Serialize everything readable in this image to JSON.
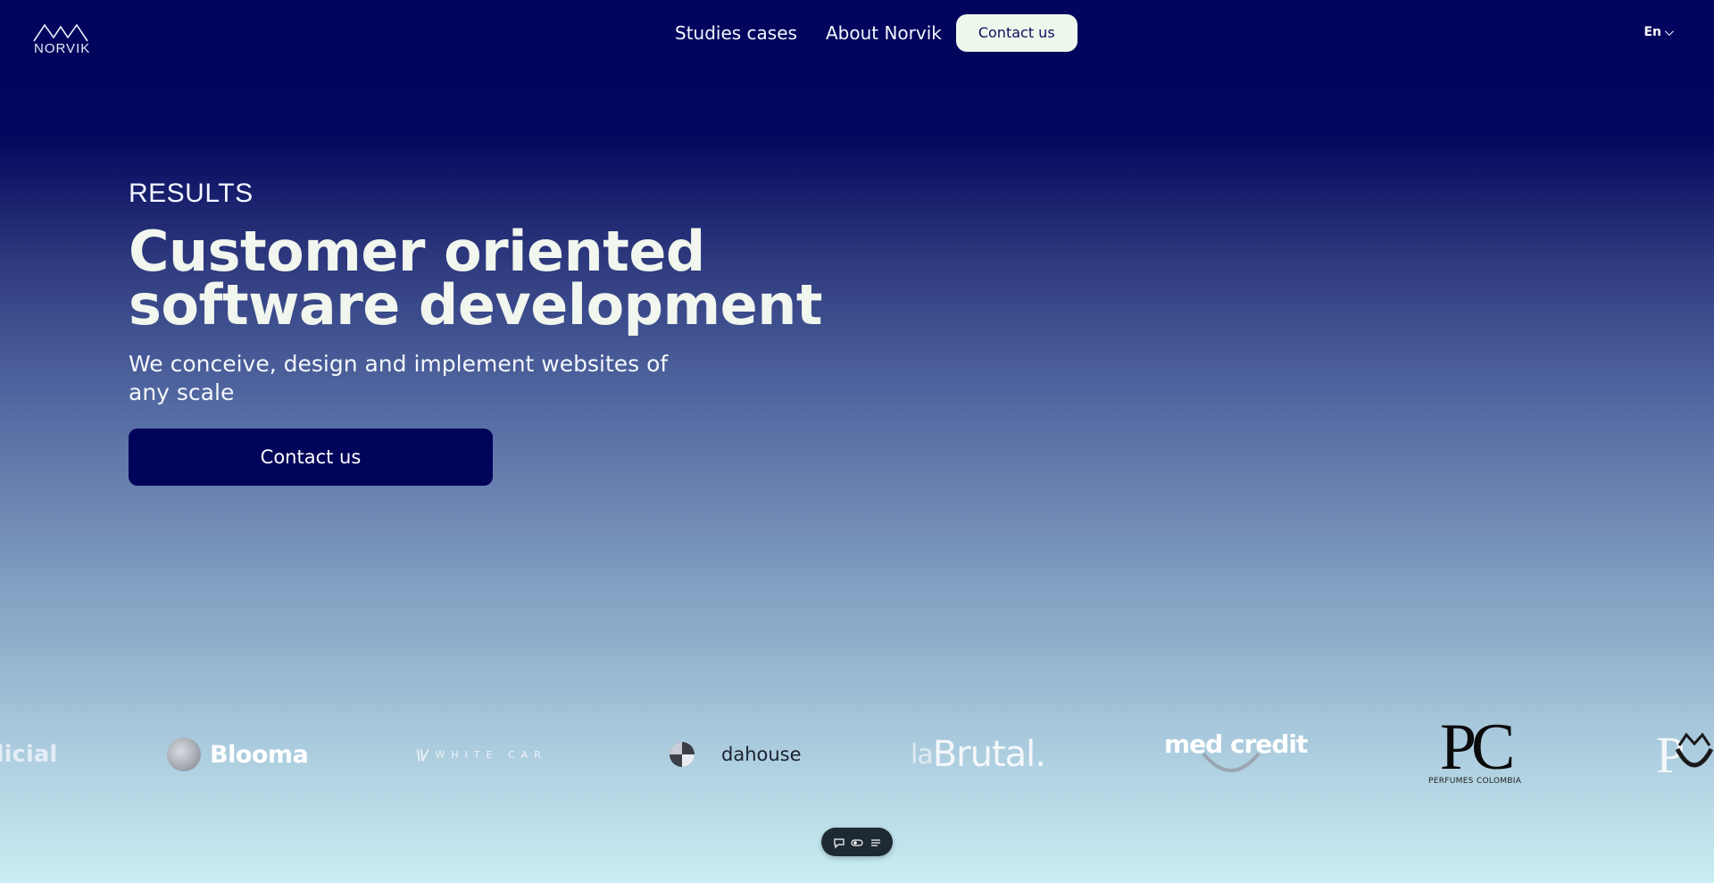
{
  "brand": {
    "name": "NORVIK"
  },
  "nav": {
    "items": [
      "Studies cases",
      "About Norvik"
    ],
    "cta": "Contact us",
    "language": "En"
  },
  "hero": {
    "eyebrow": "RESULTS",
    "title_line1": "Customer oriented",
    "title_line2": "software development",
    "subtitle": "We conceive, design and implement websites of any scale",
    "cta": "Contact us"
  },
  "logos": {
    "judicial": "dicial",
    "blooma": "Blooma",
    "white_car": "WHITE CAR",
    "dahouse": "dahouse",
    "brutal_prefix": "la",
    "brutal": "Brutal.",
    "medcredit": "med credit",
    "pc": "PC",
    "pc_sub": "PERFUMES COLOMBIA",
    "pv": "P"
  },
  "toolbar": {
    "icons": [
      "chat-icon",
      "toggle-icon",
      "settings-icon"
    ]
  }
}
